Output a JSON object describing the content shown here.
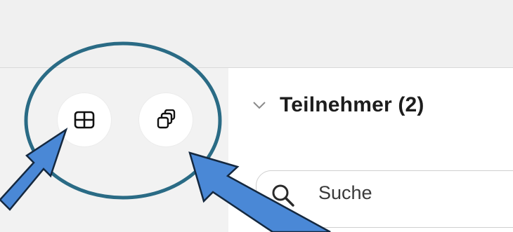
{
  "participants_section": {
    "title": "Teilnehmer (2)",
    "expanded": true
  },
  "search": {
    "placeholder": "Suche"
  },
  "view_buttons": [
    {
      "icon": "grid-icon"
    },
    {
      "icon": "stacked-windows-icon"
    }
  ],
  "annotation": {
    "circle_color": "#2a6b85",
    "arrow_color": "#4a88d6",
    "arrow_outline": "#14283f"
  }
}
